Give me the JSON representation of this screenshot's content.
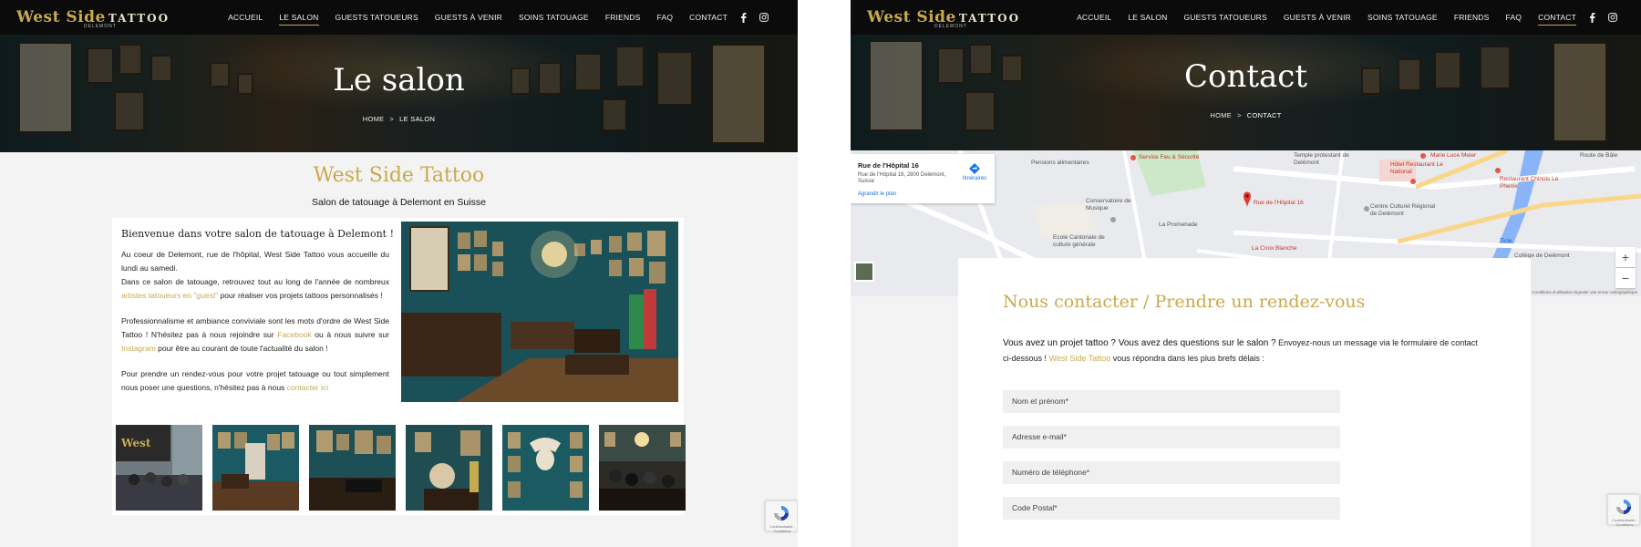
{
  "left": {
    "logo": {
      "word1": "West Side",
      "word2": "TATTOO",
      "sub": "DELEMONT"
    },
    "nav": [
      "Accueil",
      "Le salon",
      "Guests tatoueurs",
      "Guests à venir",
      "Soins tatouage",
      "Friends",
      "FAQ",
      "Contact"
    ],
    "active_nav": "Le salon",
    "hero": {
      "title": "Le salon",
      "crumb_home": "Home",
      "crumb_sep": ">",
      "crumb_current": "Le salon"
    },
    "section_title": "West Side Tattoo",
    "section_sub": "Salon de tatouage à Delemont en Suisse",
    "intro_title": "Bienvenue dans votre salon de tatouage à Delemont !",
    "p1a": "Au coeur de Delemont, rue de l'hôpital, West Side Tattoo vous accueille du lundi au samedi.",
    "p1b": "Dans ce salon de tatouage, retrouvez tout au long de l'année de nombreux ",
    "p1b_link": "artistes tatoueurs en \"guest\"",
    "p1b_end": " pour réaliser vos projets tattoos personnalisés !",
    "p2a": "Professionnalisme et ambiance conviviale sont les mots d'ordre de West Side Tattoo ! N'hésitez pas à nous rejoindre sur ",
    "p2_link1": "Facebook",
    "p2b": " ou à nous suivre sur ",
    "p2_link2": "Instagram",
    "p2c": " pour être au courant de toute l'actualité du salon !",
    "p3a": "Pour prendre un rendez-vous pour votre projet tatouage ou tout simplement nous poser une questions, n'hésitez pas à nous ",
    "p3_link": "contacter ici",
    "recaptcha_text": "Confidentialité - Conditions"
  },
  "right": {
    "logo": {
      "word1": "West Side",
      "word2": "TATTOO",
      "sub": "DELEMONT"
    },
    "nav": [
      "Accueil",
      "Le salon",
      "Guests tatoueurs",
      "Guests à venir",
      "Soins tatouage",
      "Friends",
      "FAQ",
      "Contact"
    ],
    "active_nav": "Contact",
    "hero": {
      "title": "Contact",
      "crumb_home": "Home",
      "crumb_sep": ">",
      "crumb_current": "Contact"
    },
    "map": {
      "info_title": "Rue de l'Hôpital 16",
      "info_addr": "Rue de l'Hôpital 16, 2800 Delémont, Suisse",
      "info_link": "Agrandir le plan",
      "info_dir": "Itinéraires",
      "pin_label": "Rue de l'Hôpital 16",
      "labels": {
        "pensions": "Pensions alimentaires",
        "feu": "Service Feu & Sécurité",
        "temple": "Temple protestant de Delémont",
        "marie": "Marie Luce Meier",
        "hotel": "Hôtel Restaurant Le National",
        "chinois": "Restaurant Chinois Le Phenix",
        "conservatoire": "Conservatoire de Musique",
        "ecole": "Ecole Cantonale de culture générale",
        "centre": "Centre Culturel Régional de Delémont",
        "croix": "La Croix Blanche",
        "college": "Collège de Delémont",
        "route": "Route de Bâle",
        "ticle": "Ticle",
        "prome": "La Promenade"
      },
      "terms": "Conditions d'utilisation   Signaler une erreur cartographique"
    },
    "contact_title": "Nous contacter / Prendre un rendez-vous",
    "lead_strong": "Vous avez un projet tattoo ? Vous avez des questions sur le salon ?",
    "lead_rest1": " Envoyez-nous un message via le formulaire de contact ci-dessous ! ",
    "lead_link": "West Side Tattoo",
    "lead_rest2": " vous répondra dans les plus brefs délais :",
    "fields": [
      "Nom et prénom*",
      "Adresse e-mail*",
      "Numéro de téléphone*",
      "Code Postal*"
    ],
    "recaptcha_text": "Confidentialité - Conditions"
  },
  "colors": {
    "gold": "#c8aa4e",
    "nav_bg": "#0b0b0b",
    "link": "#1a73e8"
  }
}
